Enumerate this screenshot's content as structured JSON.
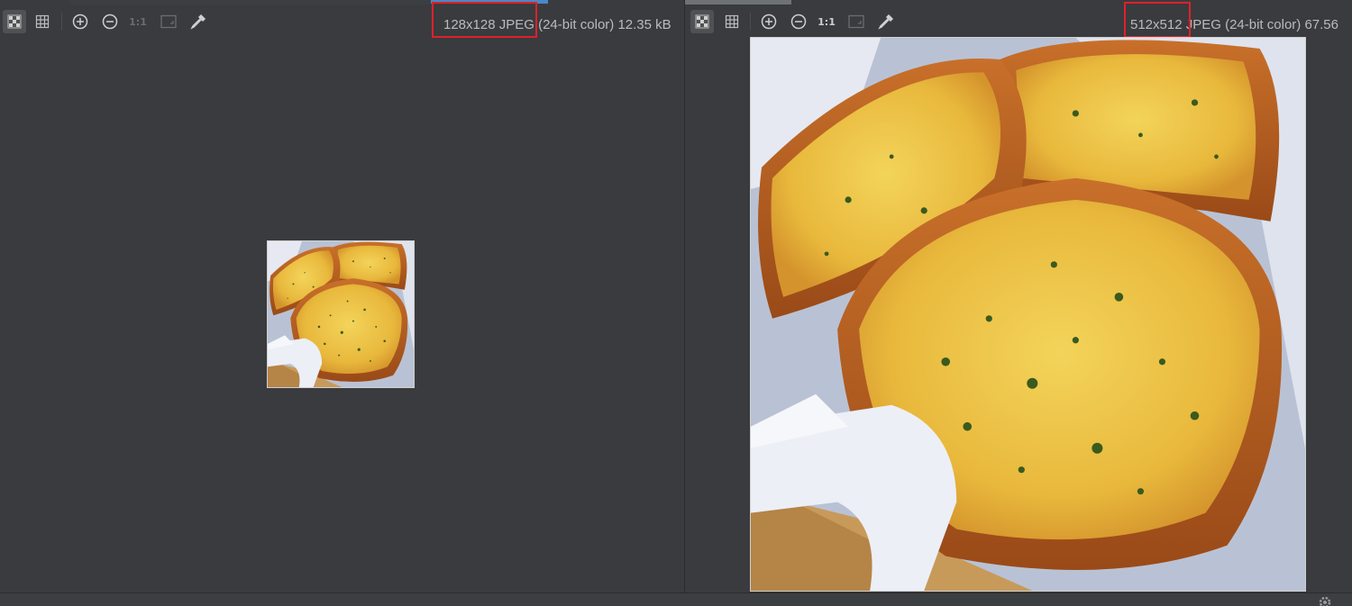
{
  "left_viewer": {
    "dimensions": "128x128",
    "details": "JPEG (24-bit color) 12.35 kB"
  },
  "right_viewer": {
    "dimensions": "512x512",
    "details": "JPEG (24-bit color) 67.56"
  },
  "toolbar": {
    "actual_size_label": "1:1"
  },
  "image": {
    "subject": "garlic-bread-photo"
  },
  "colors": {
    "background": "#393b3e",
    "highlight": "#e0202a",
    "tab_indicator": "#4a88c7"
  }
}
